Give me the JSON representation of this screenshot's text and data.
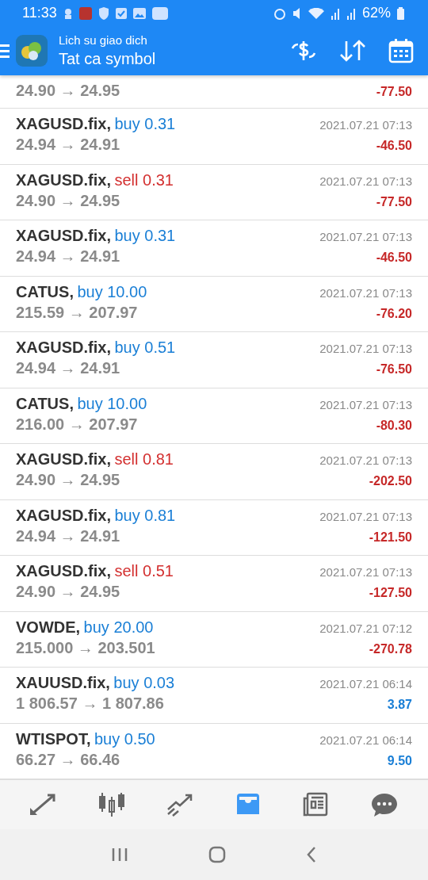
{
  "status_bar": {
    "time": "11:33",
    "battery": "62%"
  },
  "header": {
    "title": "Lich su giao dich",
    "subtitle": "Tat ca symbol"
  },
  "partial_row": {
    "prices": "24.90 → 24.95",
    "profit": "-77.50",
    "gain": false
  },
  "trades": [
    {
      "symbol": "XAGUSD.fix,",
      "kind": "buy",
      "side": "buy 0.31",
      "time": "2021.07.21 07:13",
      "prices": "24.94 → 24.91",
      "profit": "-46.50",
      "gain": false
    },
    {
      "symbol": "XAGUSD.fix,",
      "kind": "sell",
      "side": "sell 0.31",
      "time": "2021.07.21 07:13",
      "prices": "24.90 → 24.95",
      "profit": "-77.50",
      "gain": false
    },
    {
      "symbol": "XAGUSD.fix,",
      "kind": "buy",
      "side": "buy 0.31",
      "time": "2021.07.21 07:13",
      "prices": "24.94 → 24.91",
      "profit": "-46.50",
      "gain": false
    },
    {
      "symbol": "CATUS,",
      "kind": "buy",
      "side": "buy 10.00",
      "time": "2021.07.21 07:13",
      "prices": "215.59 → 207.97",
      "profit": "-76.20",
      "gain": false
    },
    {
      "symbol": "XAGUSD.fix,",
      "kind": "buy",
      "side": "buy 0.51",
      "time": "2021.07.21 07:13",
      "prices": "24.94 → 24.91",
      "profit": "-76.50",
      "gain": false
    },
    {
      "symbol": "CATUS,",
      "kind": "buy",
      "side": "buy 10.00",
      "time": "2021.07.21 07:13",
      "prices": "216.00 → 207.97",
      "profit": "-80.30",
      "gain": false
    },
    {
      "symbol": "XAGUSD.fix,",
      "kind": "sell",
      "side": "sell 0.81",
      "time": "2021.07.21 07:13",
      "prices": "24.90 → 24.95",
      "profit": "-202.50",
      "gain": false
    },
    {
      "symbol": "XAGUSD.fix,",
      "kind": "buy",
      "side": "buy 0.81",
      "time": "2021.07.21 07:13",
      "prices": "24.94 → 24.91",
      "profit": "-121.50",
      "gain": false
    },
    {
      "symbol": "XAGUSD.fix,",
      "kind": "sell",
      "side": "sell 0.51",
      "time": "2021.07.21 07:13",
      "prices": "24.90 → 24.95",
      "profit": "-127.50",
      "gain": false
    },
    {
      "symbol": "VOWDE,",
      "kind": "buy",
      "side": "buy 20.00",
      "time": "2021.07.21 07:12",
      "prices": "215.000 → 203.501",
      "profit": "-270.78",
      "gain": false
    },
    {
      "symbol": "XAUUSD.fix,",
      "kind": "buy",
      "side": "buy 0.03",
      "time": "2021.07.21 06:14",
      "prices": "1 806.57 → 1 807.86",
      "profit": "3.87",
      "gain": true
    },
    {
      "symbol": "WTISPOT,",
      "kind": "buy",
      "side": "buy 0.50",
      "time": "2021.07.21 06:14",
      "prices": "66.27 → 66.46",
      "profit": "9.50",
      "gain": true
    }
  ],
  "bottom_nav": [
    {
      "kind": "quotes",
      "selected": false
    },
    {
      "kind": "chart",
      "selected": false
    },
    {
      "kind": "trade",
      "selected": false
    },
    {
      "kind": "history",
      "selected": true
    },
    {
      "kind": "news",
      "selected": false
    },
    {
      "kind": "chat",
      "selected": false
    }
  ]
}
